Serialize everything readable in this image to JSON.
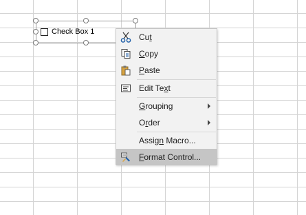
{
  "checkbox": {
    "label": "Check Box 1",
    "checked": false
  },
  "menu": {
    "items": [
      {
        "id": "cut",
        "pre": "Cu",
        "acc": "t",
        "post": "",
        "icon": "scissors-icon"
      },
      {
        "id": "copy",
        "pre": "",
        "acc": "C",
        "post": "opy",
        "icon": "copy-icon"
      },
      {
        "id": "paste",
        "pre": "",
        "acc": "P",
        "post": "aste",
        "icon": "paste-icon"
      },
      {
        "id": "edit-text",
        "pre": "Edit Te",
        "acc": "x",
        "post": "t",
        "icon": "edit-text-icon"
      },
      {
        "id": "grouping",
        "pre": "",
        "acc": "G",
        "post": "rouping",
        "submenu": true
      },
      {
        "id": "order",
        "pre": "O",
        "acc": "r",
        "post": "der",
        "submenu": true
      },
      {
        "id": "assign-macro",
        "pre": "Assig",
        "acc": "n",
        "post": " Macro..."
      },
      {
        "id": "format-control",
        "pre": "",
        "acc": "F",
        "post": "ormat Control...",
        "icon": "format-control-icon",
        "highlighted": true
      }
    ]
  },
  "colors": {
    "highlight": "#c5c5c5",
    "menu_bg": "#f2f2f2",
    "gridline": "#d4d4d4"
  }
}
